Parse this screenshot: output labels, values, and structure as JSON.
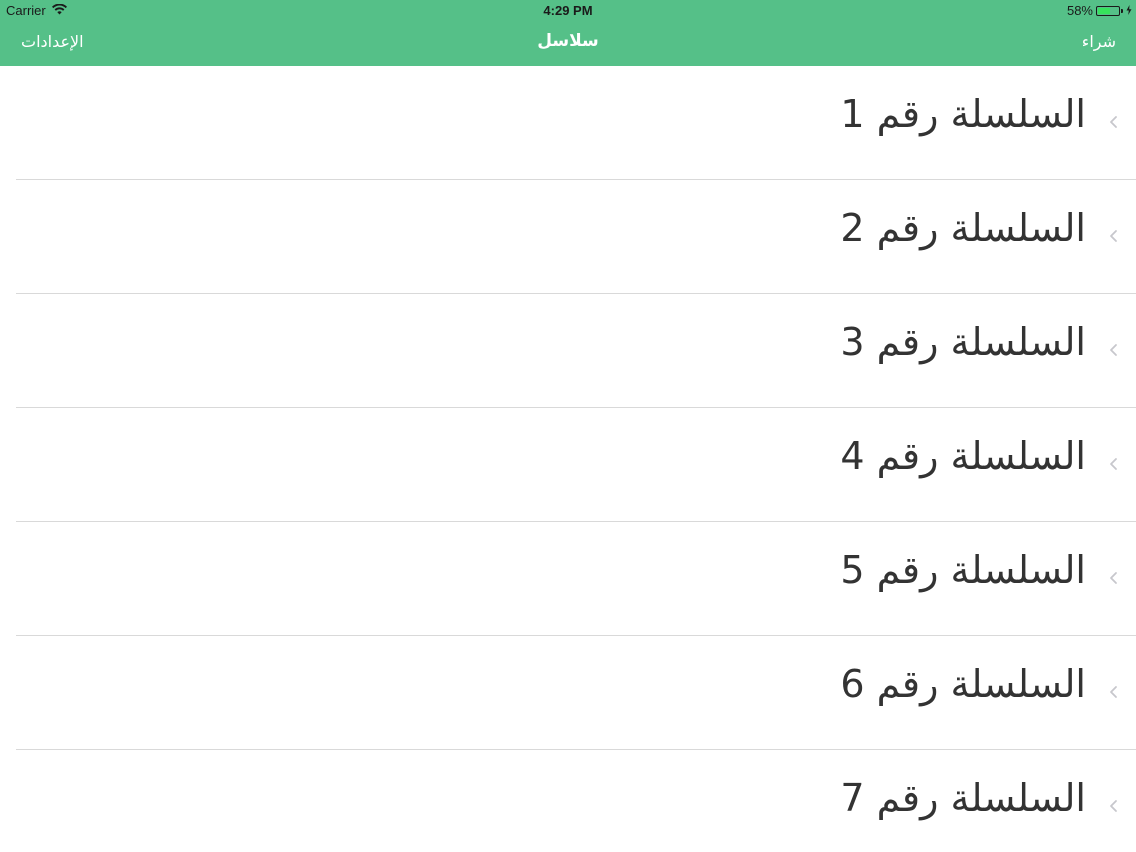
{
  "status_bar": {
    "carrier": "Carrier",
    "time": "4:29 PM",
    "battery_percent": "58%",
    "battery_level": 0.58,
    "icons": [
      "wifi-icon",
      "battery-icon",
      "charging-bolt-icon"
    ]
  },
  "nav": {
    "left_label": "الإعدادات",
    "title": "سلاسل",
    "right_label": "شراء"
  },
  "colors": {
    "accent": "#55c088",
    "text": "#333333",
    "chevron": "#c7c7cc",
    "separator": "#d9d9d9"
  },
  "list": {
    "items": [
      {
        "label": "السلسلة رقم 1"
      },
      {
        "label": "السلسلة رقم 2"
      },
      {
        "label": "السلسلة رقم 3"
      },
      {
        "label": "السلسلة رقم 4"
      },
      {
        "label": "السلسلة رقم 5"
      },
      {
        "label": "السلسلة رقم 6"
      },
      {
        "label": "السلسلة رقم 7"
      }
    ],
    "chevron_icon": "chevron-left-icon"
  }
}
